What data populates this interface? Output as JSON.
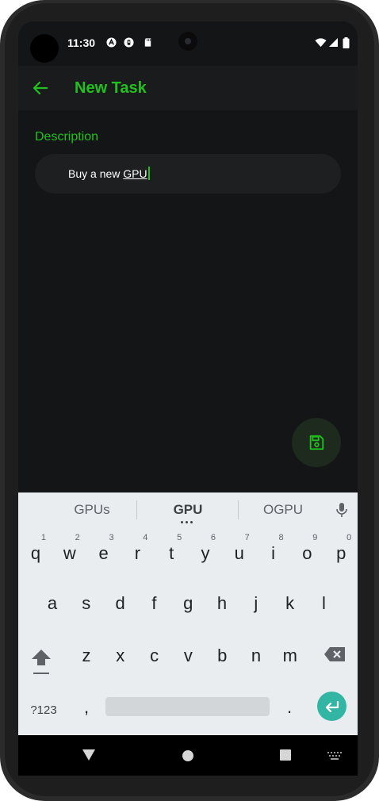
{
  "status_bar": {
    "time": "11:30"
  },
  "app_bar": {
    "title": "New Task"
  },
  "form": {
    "description_label": "Description",
    "description_prefix": "Buy a new ",
    "description_composing": "GPU"
  },
  "keyboard": {
    "suggestions": [
      "GPUs",
      "GPU",
      "OGPU"
    ],
    "row1": [
      {
        "key": "q",
        "hint": "1"
      },
      {
        "key": "w",
        "hint": "2"
      },
      {
        "key": "e",
        "hint": "3"
      },
      {
        "key": "r",
        "hint": "4"
      },
      {
        "key": "t",
        "hint": "5"
      },
      {
        "key": "y",
        "hint": "6"
      },
      {
        "key": "u",
        "hint": "7"
      },
      {
        "key": "i",
        "hint": "8"
      },
      {
        "key": "o",
        "hint": "9"
      },
      {
        "key": "p",
        "hint": "0"
      }
    ],
    "row2": [
      "a",
      "s",
      "d",
      "f",
      "g",
      "h",
      "j",
      "k",
      "l"
    ],
    "row3": [
      "z",
      "x",
      "c",
      "v",
      "b",
      "n",
      "m"
    ],
    "symbols_label": "?123",
    "comma": ",",
    "period": "."
  },
  "colors": {
    "accent": "#22c01f",
    "background": "#141517",
    "keyboard_bg": "#e9edf0",
    "enter_key": "#33b5a3"
  }
}
